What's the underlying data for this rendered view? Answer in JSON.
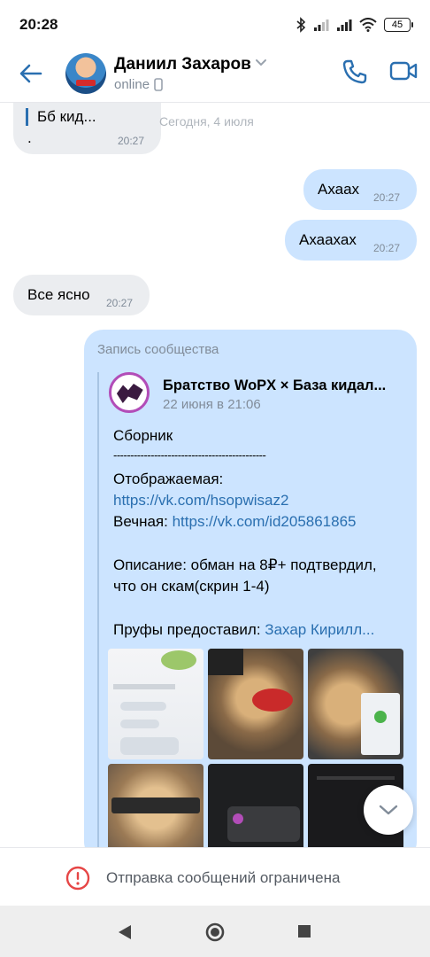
{
  "status_bar": {
    "time": "20:28",
    "battery": "45",
    "icons": [
      "bluetooth-icon",
      "signal-icon",
      "signal-icon",
      "wifi-icon",
      "battery-icon"
    ]
  },
  "header": {
    "contact_name": "Даниил Захаров",
    "presence": "online",
    "back_icon": "arrow-left-icon",
    "call_icon": "phone-icon",
    "video_icon": "video-camera-icon"
  },
  "chat": {
    "day_separator": "Сегодня, 4 июля",
    "partial_message": {
      "line1": "Бб кид...",
      "line2": ".",
      "time": "20:27"
    },
    "messages": [
      {
        "text": "Ахаах",
        "time": "20:27",
        "dir": "out"
      },
      {
        "text": "Ахаахах",
        "time": "20:27",
        "dir": "out"
      },
      {
        "text": "Все ясно",
        "time": "20:27",
        "dir": "in"
      }
    ],
    "shared_post": {
      "label": "Запись сообщества",
      "group_name": "Братство WoPX × База кидал...",
      "date": "22 июня в 21:06",
      "lines": {
        "title": "Сборник",
        "divider": "---------------------------------------------",
        "shown_label": "Отображаемая:",
        "shown_link": "https://vk.com/hsopwisaz2",
        "eternal_label": "Вечная:",
        "eternal_link": "https://vk.com/id205861865",
        "desc1": "Описание: обман на 8₽+ подтвердил,",
        "desc2": "что он скам(скрин 1-4)",
        "proofs_label": "Пруфы предоставил:",
        "proofs_users": "Захар  Кирилл..."
      }
    }
  },
  "restriction": {
    "text": "Отправка сообщений ограничена",
    "icon": "alert-circle-icon"
  },
  "colors": {
    "accent": "#2a6fb0",
    "outgoing_bubble": "#cce4ff",
    "incoming_bubble": "#ebedf0",
    "secondary_text": "#818c99",
    "restriction_red": "#e64646"
  }
}
